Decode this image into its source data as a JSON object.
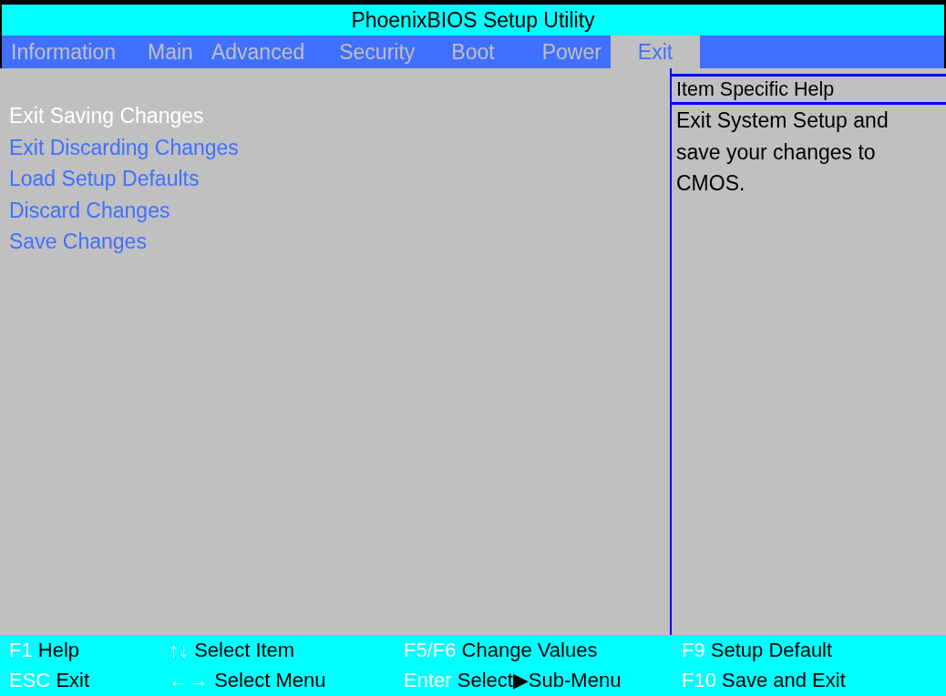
{
  "title": "PhoenixBIOS Setup Utility",
  "tabs": [
    {
      "label": "Information",
      "selected": false
    },
    {
      "label": "Main",
      "selected": false
    },
    {
      "label": "Advanced",
      "selected": false
    },
    {
      "label": "Security",
      "selected": false
    },
    {
      "label": "Boot",
      "selected": false
    },
    {
      "label": "Power",
      "selected": false
    },
    {
      "label": "Exit",
      "selected": true
    }
  ],
  "menu_items": [
    {
      "label": "Exit Saving Changes",
      "selected": true
    },
    {
      "label": "Exit Discarding Changes",
      "selected": false
    },
    {
      "label": "Load Setup Defaults",
      "selected": false
    },
    {
      "label": "Discard Changes",
      "selected": false
    },
    {
      "label": "Save Changes",
      "selected": false
    }
  ],
  "help": {
    "heading": "Item Specific Help",
    "lines": [
      "Exit System Setup and",
      "save your changes to",
      "CMOS."
    ]
  },
  "footer": [
    [
      {
        "key": "F1",
        "desc": "Help"
      },
      {
        "key": "↑↓",
        "desc": "Select Item"
      },
      {
        "key": "F5/F6",
        "desc": "Change Values"
      },
      {
        "key": "F9",
        "desc": "Setup Default"
      }
    ],
    [
      {
        "key": "ESC",
        "desc": "Exit"
      },
      {
        "key": "←→",
        "desc": "Select Menu"
      },
      {
        "key": "Enter",
        "desc": "Select▶Sub-Menu"
      },
      {
        "key": "F10",
        "desc": "Save and Exit"
      }
    ]
  ]
}
